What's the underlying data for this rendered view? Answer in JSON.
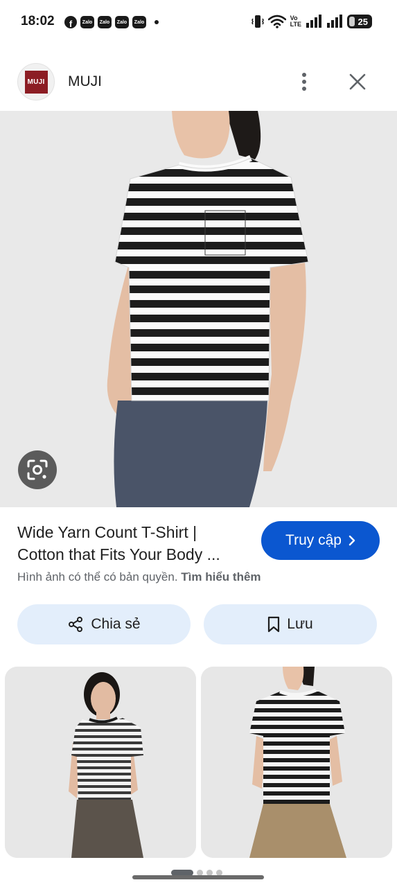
{
  "status_bar": {
    "time": "18:02",
    "notification_icons": [
      {
        "name": "facebook-icon",
        "glyph": "f"
      },
      {
        "name": "zalo-icon",
        "glyph": "Zalo"
      },
      {
        "name": "zalo-icon",
        "glyph": "Zalo"
      },
      {
        "name": "zalo-icon",
        "glyph": "Zalo"
      },
      {
        "name": "zalo-icon",
        "glyph": "Zalo"
      }
    ],
    "network_label_top": "Vo",
    "network_label_bottom": "LTE",
    "battery_level": "25"
  },
  "header": {
    "brand_logo_text": "MUJI",
    "brand_name": "MUJI",
    "more_icon": "more-vert-icon",
    "close_icon": "close-icon"
  },
  "main_image": {
    "subject": "striped-tshirt-model",
    "stripe_color": "#1c1c1c",
    "pants_color": "#4a5468",
    "lens_icon": "google-lens-icon"
  },
  "result": {
    "title_line1": "Wide Yarn Count T-Shirt |",
    "title_line2": "Cotton that Fits Your Body ...",
    "visit_label": "Truy cập",
    "copyright_text": "Hình ảnh có thể có bản quyền.",
    "learn_more": "Tìm hiểu thêm"
  },
  "actions": {
    "share_label": "Chia sẻ",
    "save_label": "Lưu"
  },
  "colors": {
    "accent": "#0b57d0",
    "action_bg": "#e3eefb",
    "brand": "#8c1d24"
  },
  "pagination": {
    "dots": 4,
    "active_index": 0
  }
}
